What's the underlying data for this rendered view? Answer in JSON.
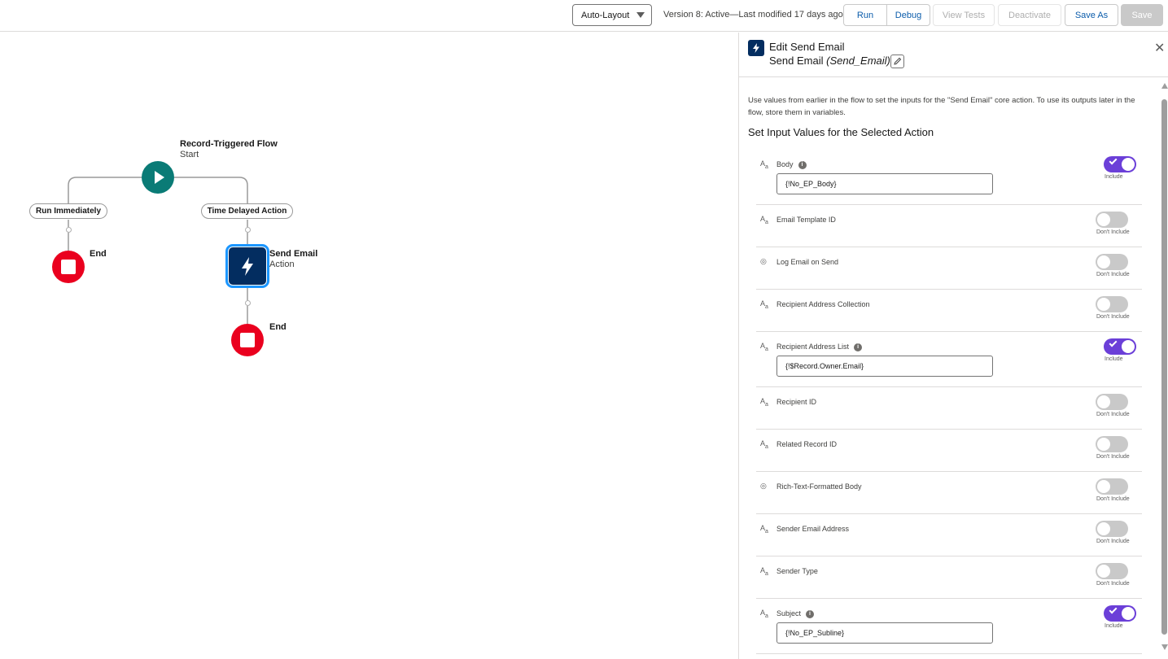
{
  "toolbar": {
    "layout_select": "Auto-Layout",
    "version": "Version 8: Active—Last modified 17 days ago",
    "run": "Run",
    "debug": "Debug",
    "view_tests": "View Tests",
    "deactivate": "Deactivate",
    "save_as": "Save As",
    "save": "Save"
  },
  "canvas": {
    "start": {
      "title": "Record-Triggered Flow",
      "subtitle": "Start"
    },
    "path_left": "Run Immediately",
    "path_right": "Time Delayed Action",
    "end_left": "End",
    "action": {
      "title": "Send Email",
      "subtitle": "Action"
    },
    "end_right": "End"
  },
  "panel": {
    "title": "Edit Send Email",
    "subtitle_name": "Send Email",
    "subtitle_api": "(Send_Email)",
    "description": "Use values from earlier in the flow to set the inputs for the \"Send Email\" core action. To use its outputs later in the flow, store them in variables.",
    "section_title": "Set Input Values for the Selected Action",
    "rows": [
      {
        "label": "Body",
        "type": "text",
        "value": "{!No_EP_Body}",
        "toggle": "Include"
      },
      {
        "label": "Email Template ID",
        "type": "text",
        "toggle": "Don't Include"
      },
      {
        "label": "Log Email on Send",
        "type": "boolean",
        "toggle": "Don't Include"
      },
      {
        "label": "Recipient Address Collection",
        "type": "text",
        "toggle": "Don't Include"
      },
      {
        "label": "Recipient Address List",
        "type": "text",
        "value": "{!$Record.Owner.Email}",
        "toggle": "Include"
      },
      {
        "label": "Recipient ID",
        "type": "text",
        "toggle": "Don't Include"
      },
      {
        "label": "Related Record ID",
        "type": "text",
        "toggle": "Don't Include"
      },
      {
        "label": "Rich-Text-Formatted Body",
        "type": "boolean",
        "toggle": "Don't Include"
      },
      {
        "label": "Sender Email Address",
        "type": "text",
        "toggle": "Don't Include"
      },
      {
        "label": "Sender Type",
        "type": "text",
        "toggle": "Don't Include"
      },
      {
        "label": "Subject",
        "type": "text",
        "value": "{!No_EP_Subline}",
        "toggle": "Include"
      }
    ]
  },
  "colors": {
    "start_node": "#0a7b76",
    "end_node": "#ea001e",
    "action_node": "#032d60",
    "toggle_on": "#6b3fd8",
    "link": "#0b5cab"
  }
}
